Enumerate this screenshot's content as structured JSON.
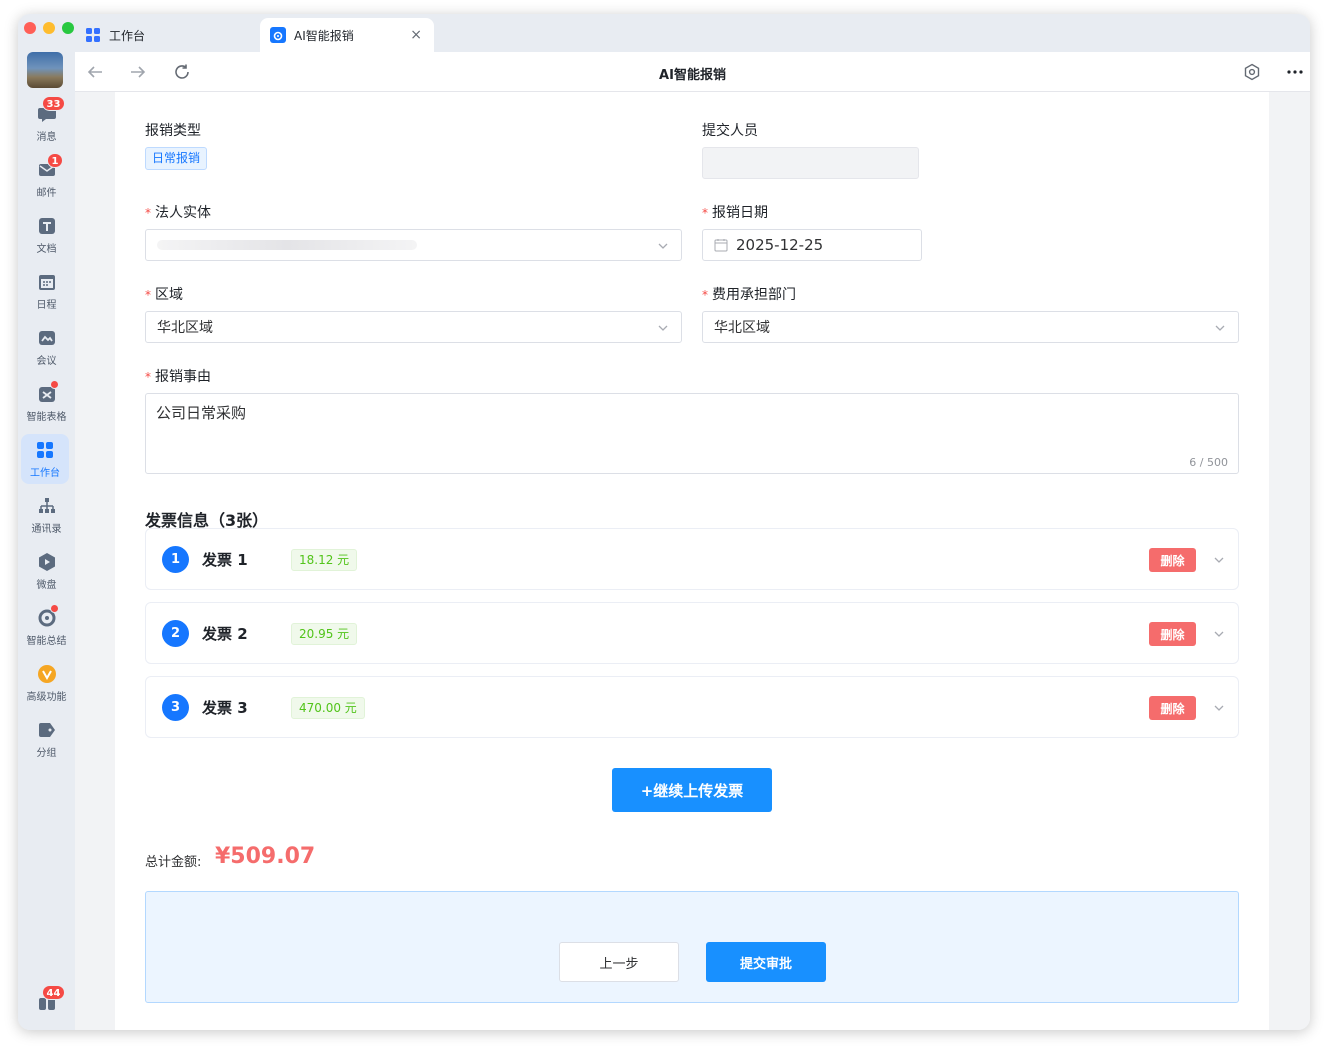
{
  "sidebar": {
    "items": [
      {
        "label": "消息",
        "icon": "chat-bubble-icon",
        "badge": "33"
      },
      {
        "label": "邮件",
        "icon": "mail-icon",
        "badge": "1"
      },
      {
        "label": "文档",
        "icon": "document-icon"
      },
      {
        "label": "日程",
        "icon": "calendar-icon"
      },
      {
        "label": "会议",
        "icon": "meeting-icon"
      },
      {
        "label": "智能表格",
        "icon": "smart-sheet-icon",
        "dot": true
      },
      {
        "label": "工作台",
        "icon": "workbench-icon",
        "active": true
      },
      {
        "label": "通讯录",
        "icon": "contacts-icon"
      },
      {
        "label": "微盘",
        "icon": "drive-icon"
      },
      {
        "label": "智能总结",
        "icon": "smart-summary-icon",
        "dot": true
      },
      {
        "label": "高级功能",
        "icon": "premium-icon"
      },
      {
        "label": "分组",
        "icon": "tag-icon"
      }
    ],
    "bottom_badge": "44"
  },
  "tabs": [
    {
      "label": "工作台",
      "icon": "workbench-icon"
    },
    {
      "label": "AI智能报销",
      "icon": "app-icon",
      "close": "×"
    }
  ],
  "addressbar": {
    "title": "AI智能报销"
  },
  "form": {
    "type_label": "报销类型",
    "type_value": "日常报销",
    "submitter_label": "提交人员",
    "entity_label": "法人实体",
    "date_label": "报销日期",
    "date_value": "2025-12-25",
    "region_label": "区域",
    "region_value": "华北区域",
    "dept_label": "费用承担部门",
    "dept_value": "华北区域",
    "reason_label": "报销事由",
    "reason_value": "公司日常采购",
    "reason_count": "6 / 500",
    "required_mark": "*"
  },
  "invoices": {
    "title": "发票信息（3张）",
    "items": [
      {
        "index": "1",
        "name": "发票 1",
        "amount": "18.12 元",
        "delete": "删除"
      },
      {
        "index": "2",
        "name": "发票 2",
        "amount": "20.95 元",
        "delete": "删除"
      },
      {
        "index": "3",
        "name": "发票 3",
        "amount": "470.00 元",
        "delete": "删除"
      }
    ],
    "upload_button": "+继续上传发票"
  },
  "total": {
    "label": "总计金额:",
    "value": "¥509.07"
  },
  "actions": {
    "prev": "上一步",
    "submit": "提交审批"
  },
  "colors": {
    "primary": "#1890ff",
    "danger": "#f56c6c",
    "success": "#52c41a",
    "badge": "#f54a45"
  }
}
